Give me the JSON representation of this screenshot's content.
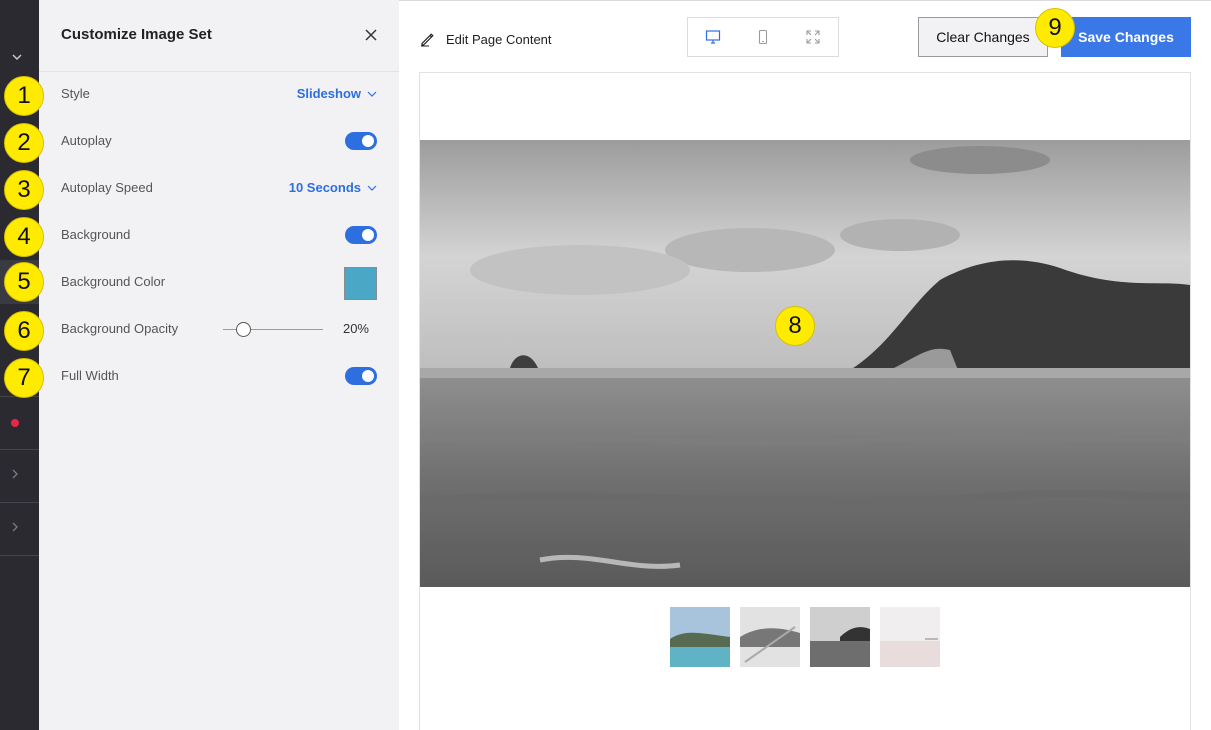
{
  "panel": {
    "title": "Customize Image Set",
    "settings": [
      {
        "label": "Style",
        "value": "Slideshow",
        "control": "dropdown"
      },
      {
        "label": "Autoplay",
        "value": "on",
        "control": "toggle"
      },
      {
        "label": "Autoplay Speed",
        "value": "10 Seconds",
        "control": "dropdown"
      },
      {
        "label": "Background",
        "value": "on",
        "control": "toggle"
      },
      {
        "label": "Background Color",
        "value": "#4aa8c6",
        "control": "color"
      },
      {
        "label": "Background Opacity",
        "value": "20%",
        "fraction": 0.2,
        "control": "slider"
      },
      {
        "label": "Full Width",
        "value": "on",
        "control": "toggle"
      }
    ]
  },
  "toolbar": {
    "edit_label": "Edit Page Content",
    "clear_label": "Clear Changes",
    "save_label": "Save Changes",
    "devices": [
      "desktop-icon",
      "mobile-icon",
      "fullscreen-icon"
    ]
  },
  "markers": [
    "1",
    "2",
    "3",
    "4",
    "5",
    "6",
    "7",
    "8",
    "9"
  ],
  "colors": {
    "accent": "#2e6fe0",
    "save_button": "#3a78e8",
    "rail": "#2a2a30",
    "panel": "#f2f2f4",
    "marker": "#ffeb00",
    "rail_dot": "#e8264a"
  }
}
